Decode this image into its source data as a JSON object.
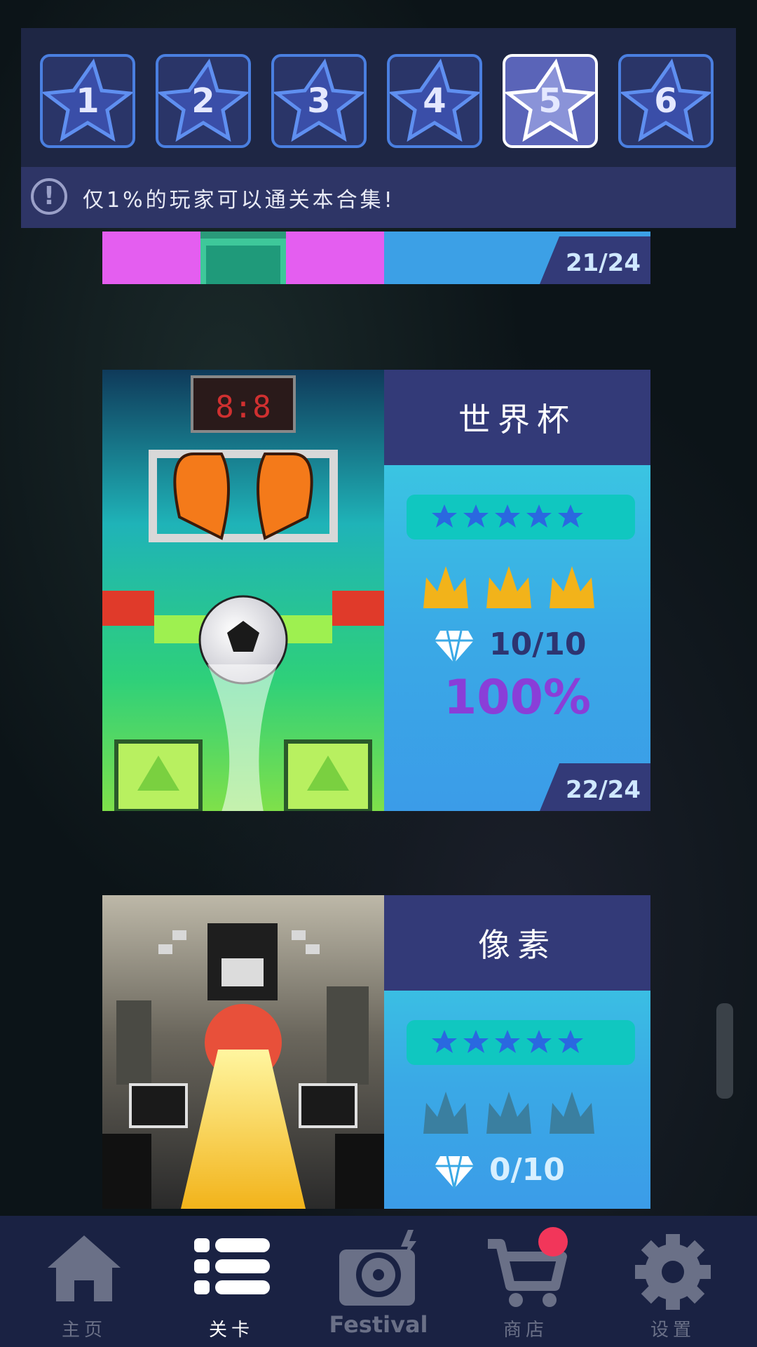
{
  "tabs": [
    {
      "label": "1",
      "active": false
    },
    {
      "label": "2",
      "active": false
    },
    {
      "label": "3",
      "active": false
    },
    {
      "label": "4",
      "active": false
    },
    {
      "label": "5",
      "active": true
    },
    {
      "label": "6",
      "active": false
    }
  ],
  "info": {
    "icon": "exclamation-icon",
    "text": "仅1%的玩家可以通关本合集!"
  },
  "cards": {
    "partial_top": {
      "count": "21/24"
    },
    "world_cup": {
      "title": "世界杯",
      "stars_filled": 5,
      "crowns_earned": 3,
      "gems": "10/10",
      "percent": "100%",
      "count": "22/24"
    },
    "pixel": {
      "title": "像素",
      "stars_filled": 5,
      "crowns_earned": 0,
      "gems": "0/10"
    }
  },
  "nav": {
    "home": "主页",
    "levels": "关卡",
    "festival": "Festival",
    "shop": "商店",
    "settings": "设置"
  },
  "colors": {
    "accent": "#4a7fe0",
    "crown_gold": "#f2b31a",
    "crown_empty": "#3a7fa0",
    "percent": "#8a3ed8",
    "badge": "#f2365a"
  }
}
